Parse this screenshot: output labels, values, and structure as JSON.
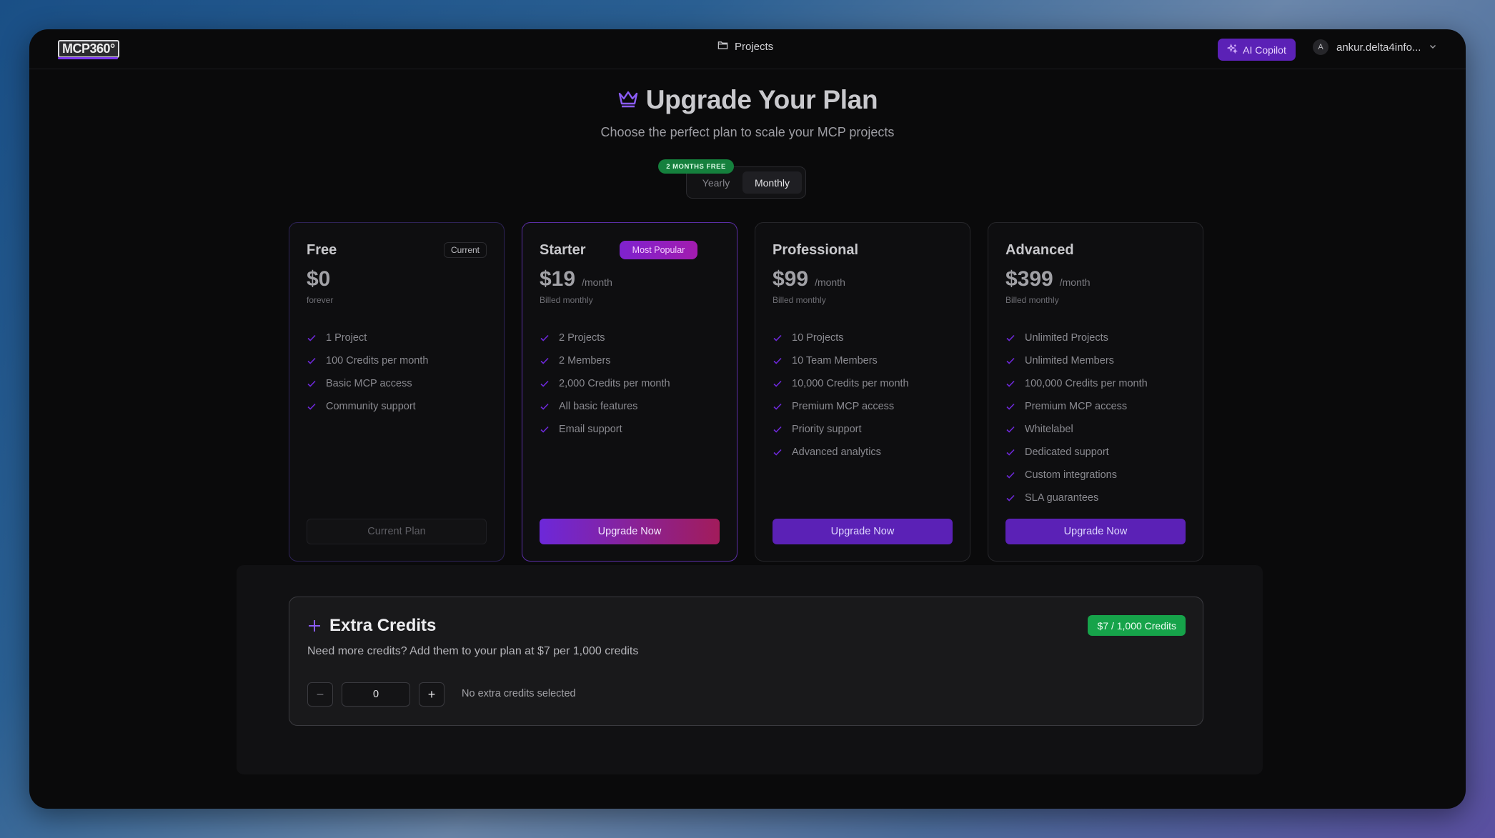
{
  "header": {
    "logo_text": "MCP360°",
    "nav_projects": "Projects",
    "copilot_label": "AI Copilot",
    "user_initial": "A",
    "user_name": "ankur.delta4info..."
  },
  "hero": {
    "title": "Upgrade Your Plan",
    "subtitle": "Choose the perfect plan to scale your MCP projects"
  },
  "billing_toggle": {
    "badge": "2 MONTHS FREE",
    "yearly": "Yearly",
    "monthly": "Monthly",
    "selected": "Monthly"
  },
  "plans": [
    {
      "name": "Free",
      "badge": "Current",
      "price": "$0",
      "period": "",
      "billing": "forever",
      "features": [
        "1 Project",
        "100 Credits per month",
        "Basic MCP access",
        "Community support"
      ],
      "button": "Current Plan"
    },
    {
      "name": "Starter",
      "ribbon": "Most Popular",
      "price": "$19",
      "period": "/month",
      "billing": "Billed monthly",
      "features": [
        "2 Projects",
        "2 Members",
        "2,000 Credits per month",
        "All basic features",
        "Email support"
      ],
      "button": "Upgrade Now"
    },
    {
      "name": "Professional",
      "price": "$99",
      "period": "/month",
      "billing": "Billed monthly",
      "features": [
        "10 Projects",
        "10 Team Members",
        "10,000 Credits per month",
        "Premium MCP access",
        "Priority support",
        "Advanced analytics"
      ],
      "button": "Upgrade Now"
    },
    {
      "name": "Advanced",
      "price": "$399",
      "period": "/month",
      "billing": "Billed monthly",
      "features": [
        "Unlimited Projects",
        "Unlimited Members",
        "100,000 Credits per month",
        "Premium MCP access",
        "Whitelabel",
        "Dedicated support",
        "Custom integrations",
        "SLA guarantees"
      ],
      "button": "Upgrade Now"
    }
  ],
  "extra_credits": {
    "title": "Extra Credits",
    "price_badge": "$7 / 1,000 Credits",
    "description": "Need more credits? Add them to your plan at $7 per 1,000 credits",
    "minus_label": "−",
    "plus_label": "+",
    "quantity": "0",
    "status": "No extra credits selected"
  },
  "colors": {
    "accent": "#5b21b6",
    "check": "#6d28d9",
    "success": "#16a34a"
  }
}
